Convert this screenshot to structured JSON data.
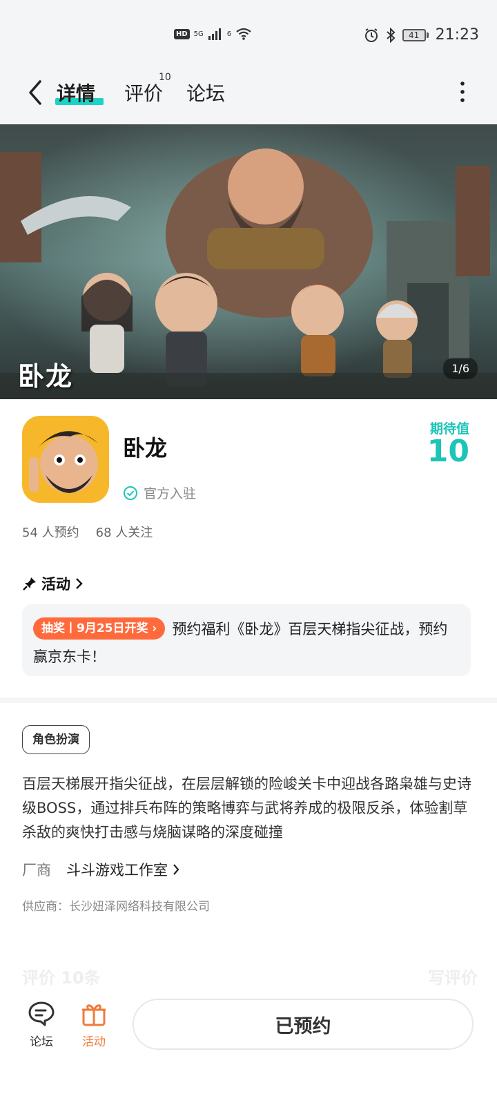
{
  "status_bar": {
    "hd": "HD",
    "network": "5G",
    "wifi_gen": "6",
    "battery": "41",
    "time": "21:23"
  },
  "nav": {
    "tab_detail": "详情",
    "tab_review": "评价",
    "review_count": "10",
    "tab_forum": "论坛"
  },
  "banner": {
    "logo_text": "卧龙",
    "counter": "1/6"
  },
  "game": {
    "title": "卧龙",
    "official_label": "官方入驻",
    "expect_label": "期待值",
    "expect_value": "10",
    "reservations": "54 人预约",
    "followers": "68 人关注"
  },
  "activity": {
    "header": "活动",
    "lottery_pill": "抽奖丨9月25日开奖",
    "text": "预约福利《卧龙》百层天梯指尖征战，预约赢京东卡！"
  },
  "description": {
    "tag": "角色扮演",
    "text": "百层天梯展开指尖征战，在层层解锁的险峻关卡中迎战各路枭雄与史诗级BOSS，通过排兵布阵的策略博弈与武将养成的极限反杀，体验割草杀敌的爽快打击感与烧脑谋略的深度碰撞",
    "vendor_label": "厂商",
    "vendor_name": "斗斗游戏工作室",
    "supplier": "供应商：长沙妞泽网络科技有限公司"
  },
  "faded": {
    "reviews": "评价 10条",
    "write_review": "写评价"
  },
  "bottom_bar": {
    "forum_label": "论坛",
    "activity_label": "活动",
    "reserved_button": "已预约"
  },
  "colors": {
    "accent": "#1cc5b8",
    "lottery": "#ff6a3d",
    "activity_tab": "#f07a3a"
  }
}
